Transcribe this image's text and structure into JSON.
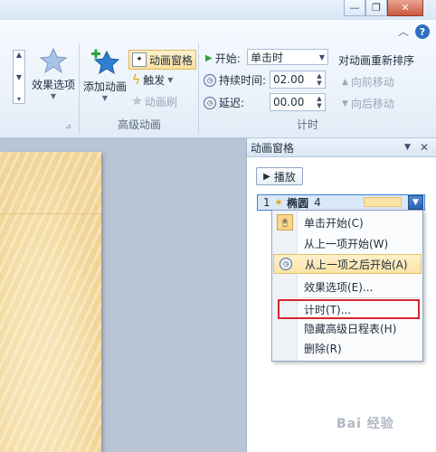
{
  "ribbon": {
    "effect_options": {
      "label": "效果选项"
    },
    "add_animation": {
      "label": "添加动画"
    },
    "animation_pane": {
      "label": "动画窗格"
    },
    "trigger": {
      "label": "触发"
    },
    "animation_painter": {
      "label": "动画刷"
    },
    "advanced_group_label": "高级动画",
    "start": {
      "label": "开始:",
      "value": "单击时"
    },
    "duration": {
      "label": "持续时间:",
      "value": "02.00"
    },
    "delay": {
      "label": "延迟:",
      "value": "00.00"
    },
    "reorder_title": "对动画重新排序",
    "move_earlier": {
      "label": "向前移动"
    },
    "move_later": {
      "label": "向后移动"
    },
    "timing_group_label": "计时"
  },
  "pane": {
    "title": "动画窗格",
    "play_label": "播放",
    "item": {
      "index": "1",
      "name": "椭圆",
      "number": "4"
    }
  },
  "menu": {
    "items": [
      {
        "label": "单击开始(C)",
        "checked": false
      },
      {
        "label": "从上一项开始(W)",
        "checked": false
      },
      {
        "label": "从上一项之后开始(A)",
        "checked": true
      },
      {
        "label": "效果选项(E)...",
        "checked": false
      },
      {
        "label": "计时(T)...",
        "checked": false,
        "highlighted": true
      },
      {
        "label": "隐藏高级日程表(H)",
        "checked": false
      },
      {
        "label": "删除(R)",
        "checked": false
      }
    ]
  },
  "colors": {
    "highlight_box": "#d6262e",
    "accent_blue": "#2d6fc1",
    "slide_bg": "#f3dba3"
  }
}
